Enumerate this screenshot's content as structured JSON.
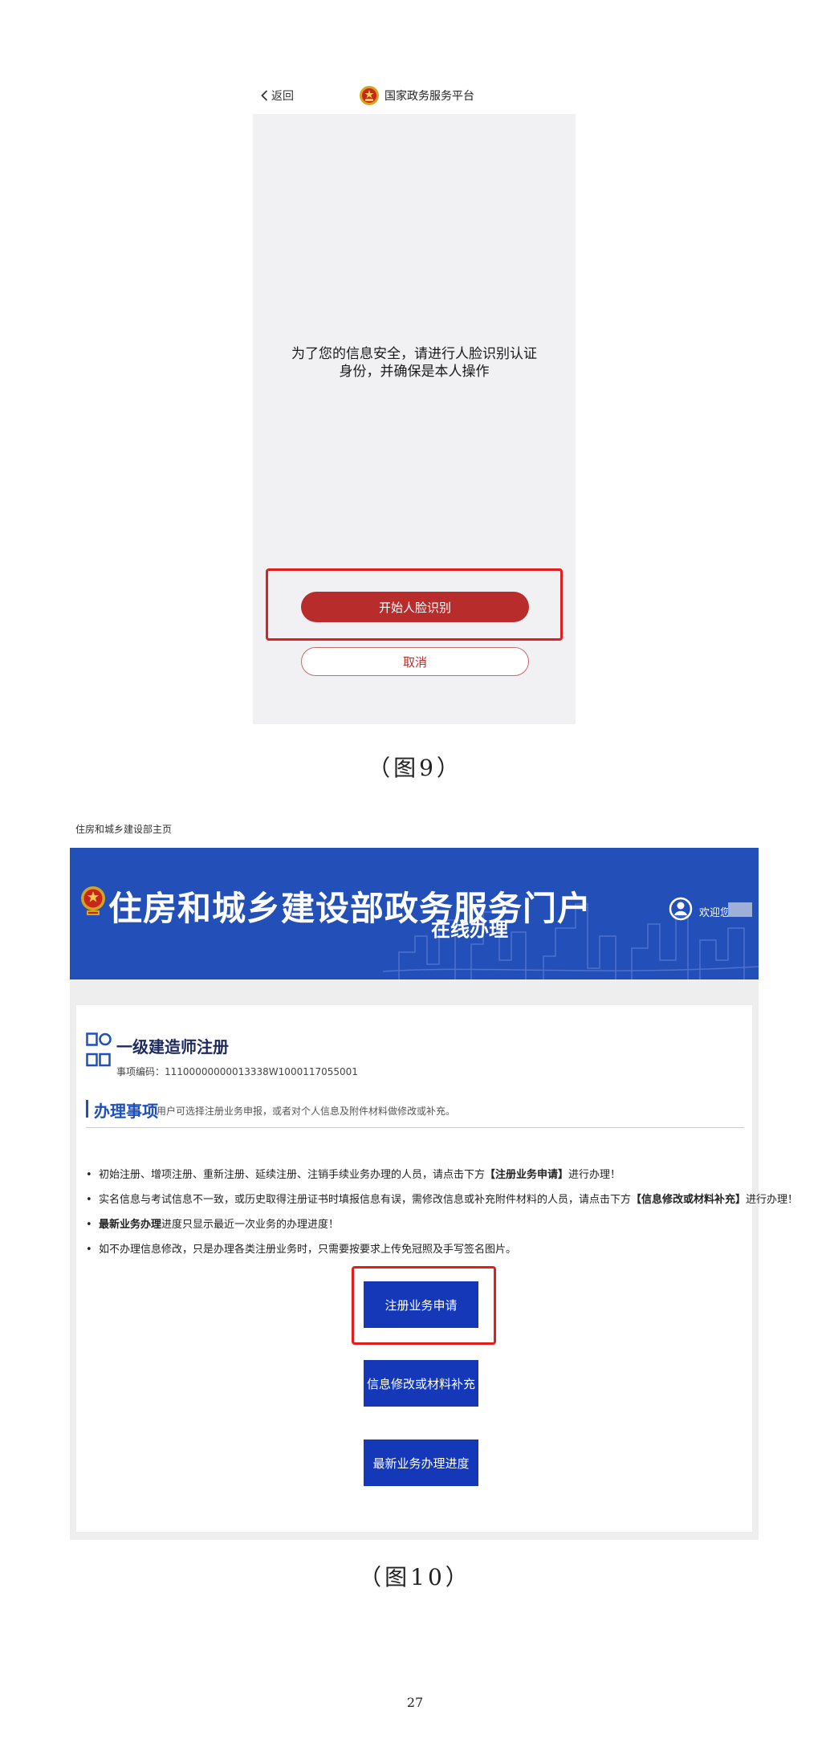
{
  "figure9": {
    "back_label": "返回",
    "platform_title": "国家政务服务平台",
    "message_line1": "为了您的信息安全，请进行人脸识别认证",
    "message_line2": "身份，并确保是本人操作",
    "start_button": "开始人脸识别",
    "cancel_button": "取消",
    "caption": "（图9）",
    "colors": {
      "primary": "#b82c2c",
      "highlight": "#e11d1d",
      "background": "#f1f1f4"
    }
  },
  "figure10": {
    "breadcrumb": "住房和城乡建设部主页",
    "portal_title": "住房和城乡建设部政务服务门户",
    "online_label": "在线办理",
    "welcome": "欢迎您",
    "service_name": "一级建造师注册",
    "code_label": "事项编码：",
    "code_value": "11100000000013338W100011705500​1",
    "section_title": "办理事项",
    "section_desc": "用户可选择注册业务申报，或者对个人信息及附件材料做修改或补充。",
    "notices": [
      {
        "text_before": "初始注册、增项注册、重新注册、延续注册、注销手续业务办理的人员，请点击下方",
        "bold": "【注册业务申请】",
        "text_after": "进行办理！"
      },
      {
        "text_before": "实名信息与考试信息不一致，或历史取得注册证书时填报信息有误，需修改信息或补充附件材料的人员，请点击下方",
        "bold": "【信息修改或材料补充】",
        "text_after": "进行办理！"
      },
      {
        "text_before": "",
        "bold": "最新业务办理",
        "text_after": "进度只显示最近一次业务的办理进度！"
      },
      {
        "text_before": "如不办理信息修改，只是办理各类注册业务时，只需要按要求上传免冠照及手写签名图片。",
        "bold": "",
        "text_after": ""
      }
    ],
    "buttons": {
      "apply": "注册业务申请",
      "modify": "信息修改或材料补充",
      "progress": "最新业务办理进度"
    },
    "caption": "（图10）",
    "colors": {
      "banner": "#2350b8",
      "button": "#1438b8",
      "highlight": "#e11d1d"
    }
  },
  "page_number": "27"
}
